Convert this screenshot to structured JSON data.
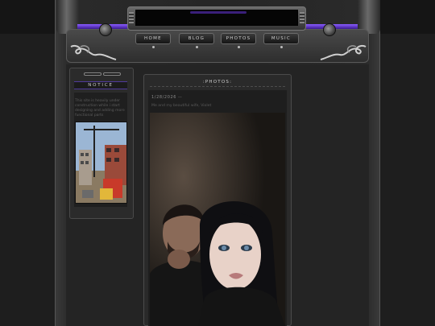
{
  "nav": {
    "items": [
      "HOME",
      "BLOG",
      "PHOTOS",
      "MUSIC"
    ]
  },
  "notice": {
    "title": "NOTICE",
    "text": "This site is heavily under construction while i start designing and adding more functional parts",
    "image_icon": "construction-site-photo"
  },
  "photos": {
    "title": ":PHOTOS:",
    "post": {
      "date": "1/28/2026 --",
      "caption": "Me and my beautiful wife, Violet",
      "image_icon": "couple-selfie-photo"
    }
  },
  "colors": {
    "accent_purple": "#6b3fd8",
    "chrome": "#6a6a6a",
    "background": "#1c1c1c"
  }
}
